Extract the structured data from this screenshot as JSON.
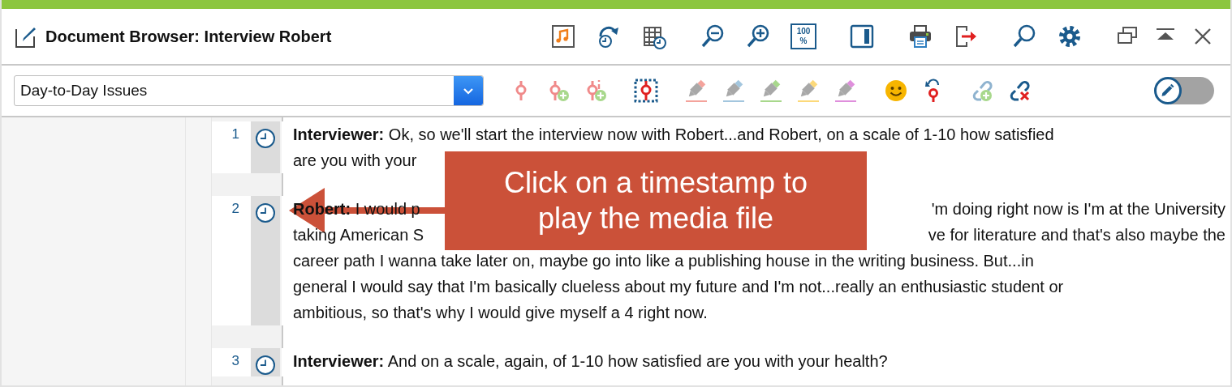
{
  "window": {
    "title": "Document Browser: Interview Robert",
    "zoom_label": "100 %"
  },
  "code_dropdown": {
    "value": "Day-to-Day Issues"
  },
  "highlighters": [
    {
      "color": "#f4a39c"
    },
    {
      "color": "#a3c6de"
    },
    {
      "color": "#a8d88c"
    },
    {
      "color": "#fcd97a"
    },
    {
      "color": "#df8fdc"
    }
  ],
  "edit_toggle": {
    "on": false
  },
  "paragraphs": [
    {
      "number": "1",
      "lines": [
        [
          "**Interviewer:** Ok, so we'll start the interview now with Robert...and Robert, on a scale of 1-10 how satisfied"
        ],
        [
          "are you with your"
        ]
      ]
    },
    {
      "number": "2",
      "lines": [
        [
          "**Robert:** I would p",
          "'m doing right now is I'm at the University"
        ],
        [
          "taking American S",
          "ve for literature and that's also maybe the"
        ],
        [
          "career path I wanna take later on, maybe go into like a publishing house in the writing business. But...in"
        ],
        [
          "general I would say that I'm basically clueless about my future and I'm not...really an enthusiastic student or"
        ],
        [
          "ambitious, so that's why I would give myself a 4 right now."
        ]
      ]
    },
    {
      "number": "3",
      "lines": [
        [
          "**Interviewer:** And on a scale, again, of 1-10 how satisfied are you with your health?"
        ]
      ]
    }
  ],
  "callout": {
    "text": "Click on a timestamp to play the media file"
  }
}
